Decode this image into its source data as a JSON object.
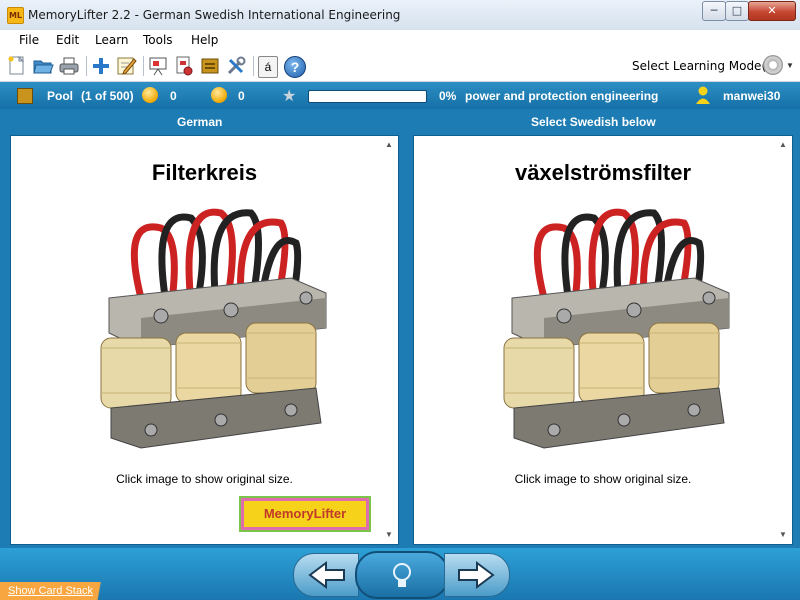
{
  "window": {
    "app_icon_text": "ML",
    "title": "MemoryLifter 2.2 - German Swedish International Engineering",
    "min_glyph": "─",
    "max_glyph": "□",
    "close_glyph": "✕"
  },
  "menu": [
    "File",
    "Edit",
    "Learn",
    "Tools",
    "Help"
  ],
  "toolbar": {
    "icons": [
      "new-document-icon",
      "open-folder-icon",
      "print-icon",
      "add-icon",
      "edit-icon",
      "presentation-icon",
      "print-cards-icon",
      "box-icon",
      "tools-icon",
      "special-character-icon",
      "help-icon"
    ],
    "special_char": "á",
    "help_glyph": "?",
    "mode_label": "Select Learning Mode(s)"
  },
  "status": {
    "pool_label": "Pool",
    "pool_count": "(1 of 500)",
    "correct_count": "0",
    "wrong_count": "0",
    "progress": 0,
    "progress_label": "0%",
    "chapter": "power and protection engineering",
    "user": "manwei30"
  },
  "columns": {
    "left": "German",
    "right": "Select Swedish below"
  },
  "card": {
    "question_word": "Filterkreis",
    "answer_word": "växelströmsfilter",
    "image_hint_left": "Click image to show original size.",
    "image_hint_right": "Click image to show original size."
  },
  "logo_text": "MemoryLifter",
  "footer": {
    "show_card_stack": "Show Card Stack"
  },
  "colors": {
    "accent_blue": "#1c7cb3",
    "status_blue": "#1570a7",
    "progress_green": "#4db84a",
    "tab_orange": "#f8a63f"
  }
}
